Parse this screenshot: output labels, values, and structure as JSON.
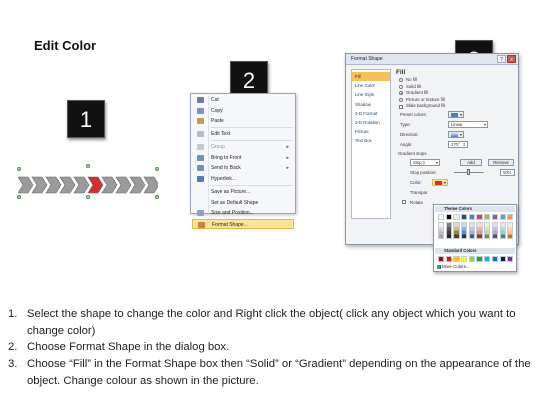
{
  "page": {
    "title": "Edit Color"
  },
  "badges": [
    "1",
    "2",
    "3"
  ],
  "context_menu": {
    "items": [
      {
        "label": "Cut",
        "icon": "scissors-icon",
        "color": "#6b7fa5",
        "underline": "t"
      },
      {
        "label": "Copy",
        "icon": "copy-icon",
        "color": "#7a93c6"
      },
      {
        "label": "Paste",
        "icon": "paste-icon",
        "color": "#c79b4f"
      },
      {
        "sep": true
      },
      {
        "label": "Edit Text",
        "icon": "edit-text-icon",
        "color": "#b5bcc9"
      },
      {
        "sep": true
      },
      {
        "label": "Group",
        "icon": "group-icon",
        "color": "#c3c8d2",
        "submenu": true,
        "disabled": true
      },
      {
        "label": "Bring to Front",
        "icon": "bring-front-icon",
        "color": "#6f8fc7",
        "submenu": true
      },
      {
        "label": "Send to Back",
        "icon": "send-back-icon",
        "color": "#6f8fc7",
        "submenu": true
      },
      {
        "label": "Hyperlink...",
        "icon": "hyperlink-icon",
        "color": "#4f7ac0"
      },
      {
        "sep": true
      },
      {
        "label": "Save as Picture...",
        "icon": "",
        "color": ""
      },
      {
        "label": "Set as Default Shape",
        "icon": "",
        "color": ""
      },
      {
        "label": "Size and Position...",
        "icon": "size-position-icon",
        "color": "#8aa2cc"
      },
      {
        "label": "Format Shape...",
        "icon": "format-shape-icon",
        "color": "#d77a3b",
        "highlight": true
      }
    ]
  },
  "dialog": {
    "title": "Format Shape",
    "help": "?",
    "close": "x",
    "nav": [
      "Fill",
      "Line Color",
      "Line Style",
      "Shadow",
      "3-D Format",
      "3-D Rotation",
      "Picture",
      "Text Box"
    ],
    "nav_active": 0,
    "section": "Fill",
    "fill_options": [
      {
        "label": "No fill",
        "checked": false
      },
      {
        "label": "Solid fill",
        "checked": false
      },
      {
        "label": "Gradient fill",
        "checked": true
      },
      {
        "label": "Picture or texture fill",
        "checked": false
      },
      {
        "label": "Slide background fill",
        "checked": false
      }
    ],
    "preset_colors_label": "Preset colors:",
    "type_label": "Type:",
    "type_value": "Linear",
    "direction_label": "Direction:",
    "angle_label": "Angle:",
    "angle_value": "270°",
    "gradient_stops_label": "Gradient stops",
    "stop_value": "Stop 1",
    "add_label": "Add",
    "remove_label": "Remove",
    "stop_position_label": "Stop position:",
    "stop_position_value": "50%",
    "color_label": "Color:",
    "transparency_label": "Transpar",
    "rotate_label": "Rotate",
    "close_label": "Close"
  },
  "color_dropdown": {
    "theme_label": "Theme Colors",
    "standard_label": "Standard Colors",
    "more_label": "More Colors...",
    "theme_top": [
      "#ffffff",
      "#000000",
      "#eeece1",
      "#1f497d",
      "#4f81bd",
      "#c0504d",
      "#9bbb59",
      "#8064a2",
      "#4bacc6",
      "#f79646"
    ],
    "theme_columns": [
      [
        "#f2f2f2",
        "#d8d8d8",
        "#bfbfbf",
        "#a5a5a5"
      ],
      [
        "#7f7f7f",
        "#595959",
        "#3f3f3f",
        "#262626"
      ],
      [
        "#ddd9c3",
        "#c4bd97",
        "#938953",
        "#494429"
      ],
      [
        "#c6d9f0",
        "#8db3e2",
        "#548dd4",
        "#17365d"
      ],
      [
        "#dbe5f1",
        "#b8cce4",
        "#95b3d7",
        "#366092"
      ],
      [
        "#f2dcdb",
        "#e5b9b7",
        "#d99694",
        "#953734"
      ],
      [
        "#ebf1dd",
        "#d7e3bc",
        "#c3d69b",
        "#76923c"
      ],
      [
        "#e5e0ec",
        "#ccc1d9",
        "#b2a2c7",
        "#5f497a"
      ],
      [
        "#dbeef3",
        "#b7dde8",
        "#92cddc",
        "#31859b"
      ],
      [
        "#fdeada",
        "#fbd5b5",
        "#fac08f",
        "#e36c09"
      ]
    ],
    "standard": [
      "#c00000",
      "#ff0000",
      "#ffc000",
      "#ffff00",
      "#92d050",
      "#00b050",
      "#00b0f0",
      "#0070c0",
      "#002060",
      "#7030a0"
    ]
  },
  "arrow_chain": {
    "count": 10,
    "highlight_index": 5,
    "base_color": "#9a9a9a",
    "highlight_color": "#d22f2f"
  },
  "instructions": [
    {
      "num": "1.",
      "text": "Select the shape to change the color and Right click the object( click any object which you want to change color)"
    },
    {
      "num": "2.",
      "text": "Choose Format Shape in the dialog box."
    },
    {
      "num": "3.",
      "text": "Choose “Fill” in the Format Shape box then “Solid” or “Gradient” depending on the appearance of the object. Change colour as shown in the picture."
    }
  ]
}
